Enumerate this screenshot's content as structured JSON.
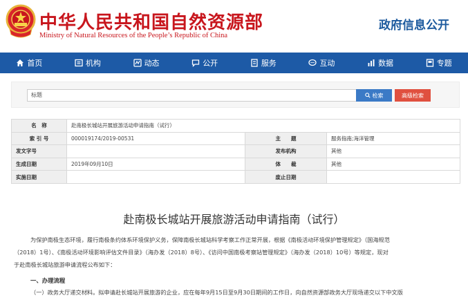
{
  "header": {
    "title_cn": "中华人民共和国自然资源部",
    "title_en": "Ministry of Natural Resources of the People’s Republic of China",
    "gov_info": "政府信息公开"
  },
  "nav": {
    "items": [
      {
        "label": "首页",
        "icon": "home-icon"
      },
      {
        "label": "机构",
        "icon": "institution-icon"
      },
      {
        "label": "动态",
        "icon": "news-icon"
      },
      {
        "label": "公开",
        "icon": "chat-icon"
      },
      {
        "label": "服务",
        "icon": "service-icon"
      },
      {
        "label": "互动",
        "icon": "interaction-icon"
      },
      {
        "label": "数据",
        "icon": "bar-chart-icon"
      },
      {
        "label": "专题",
        "icon": "topic-icon"
      }
    ]
  },
  "search": {
    "select_value": "标题",
    "search_label": "检索",
    "advanced_label": "高级检索"
  },
  "meta": {
    "name_label": "名　称",
    "name_value": "赴南极长城站开展旅游活动申请指南（试行）",
    "index_label": "索 引 号",
    "index_value": "000019174/2019-00531",
    "subject_label": "主　　题",
    "subject_value": "服务指南;海洋管理",
    "doc_no_label": "发文字号",
    "doc_no_value": "",
    "issuer_label": "发布机构",
    "issuer_value": "其他",
    "created_label": "生成日期",
    "created_value": "2019年09月10日",
    "genre_label": "体　　裁",
    "genre_value": "其他",
    "effective_label": "实施日期",
    "effective_value": "",
    "repeal_label": "废止日期",
    "repeal_value": ""
  },
  "document": {
    "title": "赴南极长城站开展旅游活动申请指南（试行）",
    "p1_line1": "为保护南极生态环境，履行南极条约体系环境保护义务，保障南极长城站科学考察工作正常开展，根据《南极活动环境保护管理规定》（国海规范",
    "p1_line2": "（2018）1号）、《南极活动环境影响评估文件目录》（海办发（2018）8号）、《访问中国南极考察站管理规定》（海办发（2018）10号）等规定，现对",
    "p1_line3": "于赴南极长城站旅游申请流程公布如下：",
    "section1": "一、办理流程",
    "p2_line1": "（一）政务大厅递交材料。拟申请赴长城站开展旅游的企业，应在每年9月15日至9月30日期间的工作日，向自然资源部政务大厅现场递交以下中文版"
  },
  "colors": {
    "brand_red": "#c8161d",
    "nav_blue": "#1d5aa6",
    "search_blue": "#3b7ac6",
    "advanced_red": "#e0503f"
  }
}
